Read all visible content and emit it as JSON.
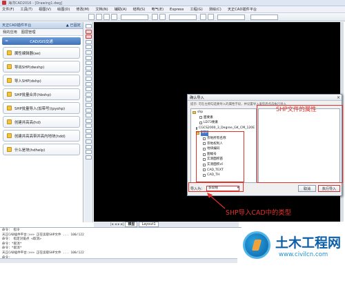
{
  "window": {
    "title": "海洋CAD2016 - [Drawing1.dwg]"
  },
  "menu": [
    "文件(F)",
    "工具(T)",
    "视图(V)",
    "绘图(D)",
    "修改(M)",
    "文档(N)",
    "辅助(A)",
    "结构(S)",
    "电气(E)",
    "Express",
    "工程(G)",
    "测绘(C)",
    "天正CAD插件平台"
  ],
  "panel": {
    "title": "天正CAD插件平台",
    "title_right": "▲ 已固定",
    "tabs": [
      "我的应用",
      "图层管理"
    ],
    "group": "CAD/GIS交通",
    "commands": [
      "属性编辑器(ae)",
      "导出SHP(dwshp)",
      "导入SHP(dshp)",
      "SHP批量合并(hbshp)",
      "SHP批量导入(加带号)(pyshp)",
      "创建并高高(hd)",
      "创建并高高带并高内地块(hdd)",
      "什么是块(hdhelp)"
    ]
  },
  "model_tabs": [
    "模型",
    "Layout1"
  ],
  "command_history": [
    "命令： 指令",
    "天正CAD插件平台:>>> 正在读取SHP文件 ... 100/122",
    "命令： 指定对角点 <取消>",
    "命令：*取消*",
    "命令：*取消*",
    "天正CAD插件平台:>>> 正在读取SHP文件 ... 100/122",
    "命令："
  ],
  "dialog": {
    "title": "确认导入",
    "close": "×",
    "info": "提示: 可在左侧勾选要导入的属性字段，并设置导入类型后点击执行导入",
    "tree": [
      {
        "label": "shp",
        "kind": "fold",
        "indent": 0
      },
      {
        "label": "面要素",
        "kind": "box",
        "indent": 2
      },
      {
        "label": "LD73要素",
        "kind": "box",
        "indent": 2
      },
      {
        "label": "CGCS2000_3_Degree_GK_CM_120E",
        "kind": "box",
        "indent": 1
      },
      {
        "label": "SHP",
        "kind": "fold",
        "indent": 1,
        "selected": true
      },
      {
        "label": "宗地所有名称",
        "kind": "box",
        "indent": 3
      },
      {
        "label": "宗地权利人",
        "kind": "box",
        "indent": 3
      },
      {
        "label": "地块编码",
        "kind": "box",
        "indent": 3
      },
      {
        "label": "图幅号",
        "kind": "box",
        "indent": 3
      },
      {
        "label": "实测面积亩",
        "kind": "box",
        "indent": 3
      },
      {
        "label": "实测面积㎡",
        "kind": "box",
        "indent": 3
      },
      {
        "label": "CAD_TEXT",
        "kind": "box",
        "indent": 3
      },
      {
        "label": "CAD_TH",
        "kind": "box",
        "indent": 3
      }
    ],
    "properties_annotation": "SHP文件的属性",
    "import_as_label": "导入为：",
    "import_as_value": "多段线",
    "cancel_label": "取消",
    "ok_label": "执行导入"
  },
  "annotations": {
    "import_type": "SHP导入CAD中的类型",
    "color": "#e0312b"
  },
  "watermark": {
    "title": "土木工程网",
    "url": "www.civilcn.com"
  }
}
